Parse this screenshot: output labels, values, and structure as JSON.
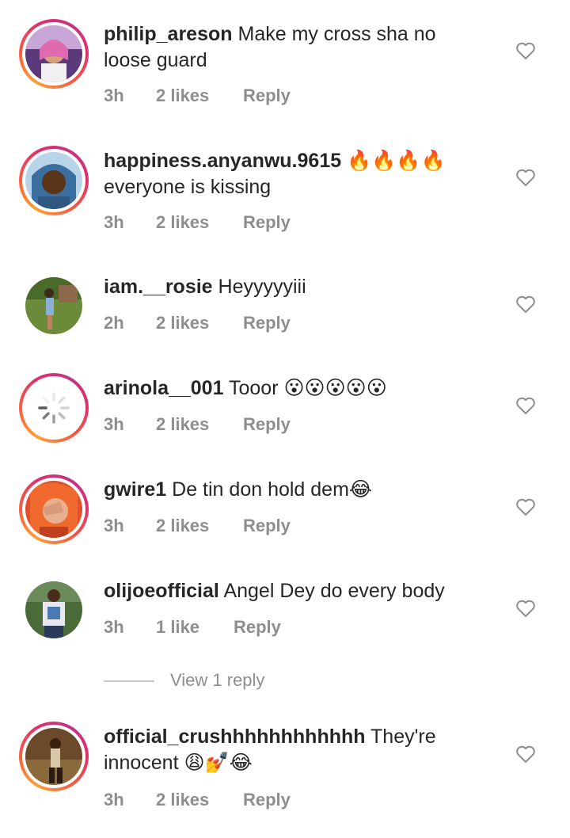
{
  "comments": [
    {
      "username": "philip_areson",
      "text": "Make my cross sha no loose guard",
      "time": "3h",
      "likes": "2 likes",
      "reply": "Reply"
    },
    {
      "username": "happiness.anyanwu.9615",
      "text": "🔥🔥🔥🔥 everyone is kissing",
      "time": "3h",
      "likes": "2 likes",
      "reply": "Reply"
    },
    {
      "username": "iam.__rosie",
      "text": "Heyyyyyiii",
      "time": "2h",
      "likes": "2 likes",
      "reply": "Reply"
    },
    {
      "username": "arinola__001",
      "text": "Tooor 😮😮😮😮😮",
      "time": "3h",
      "likes": "2 likes",
      "reply": "Reply"
    },
    {
      "username": "gwire1",
      "text": "De tin don hold dem😂",
      "time": "3h",
      "likes": "2 likes",
      "reply": "Reply"
    },
    {
      "username": "olijoeofficial",
      "text": "Angel Dey do every body",
      "time": "3h",
      "likes": "1 like",
      "reply": "Reply"
    },
    {
      "username": "official_crushhhhhhhhhhhh",
      "text": "They're innocent 😩💅😂",
      "time": "3h",
      "likes": "2 likes",
      "reply": "Reply"
    }
  ],
  "view_replies": "View 1 reply",
  "colors": {
    "ring_start": "#f9a13a",
    "ring_end": "#c13584",
    "meta_gray": "#8e8e8e",
    "text": "#262626"
  }
}
